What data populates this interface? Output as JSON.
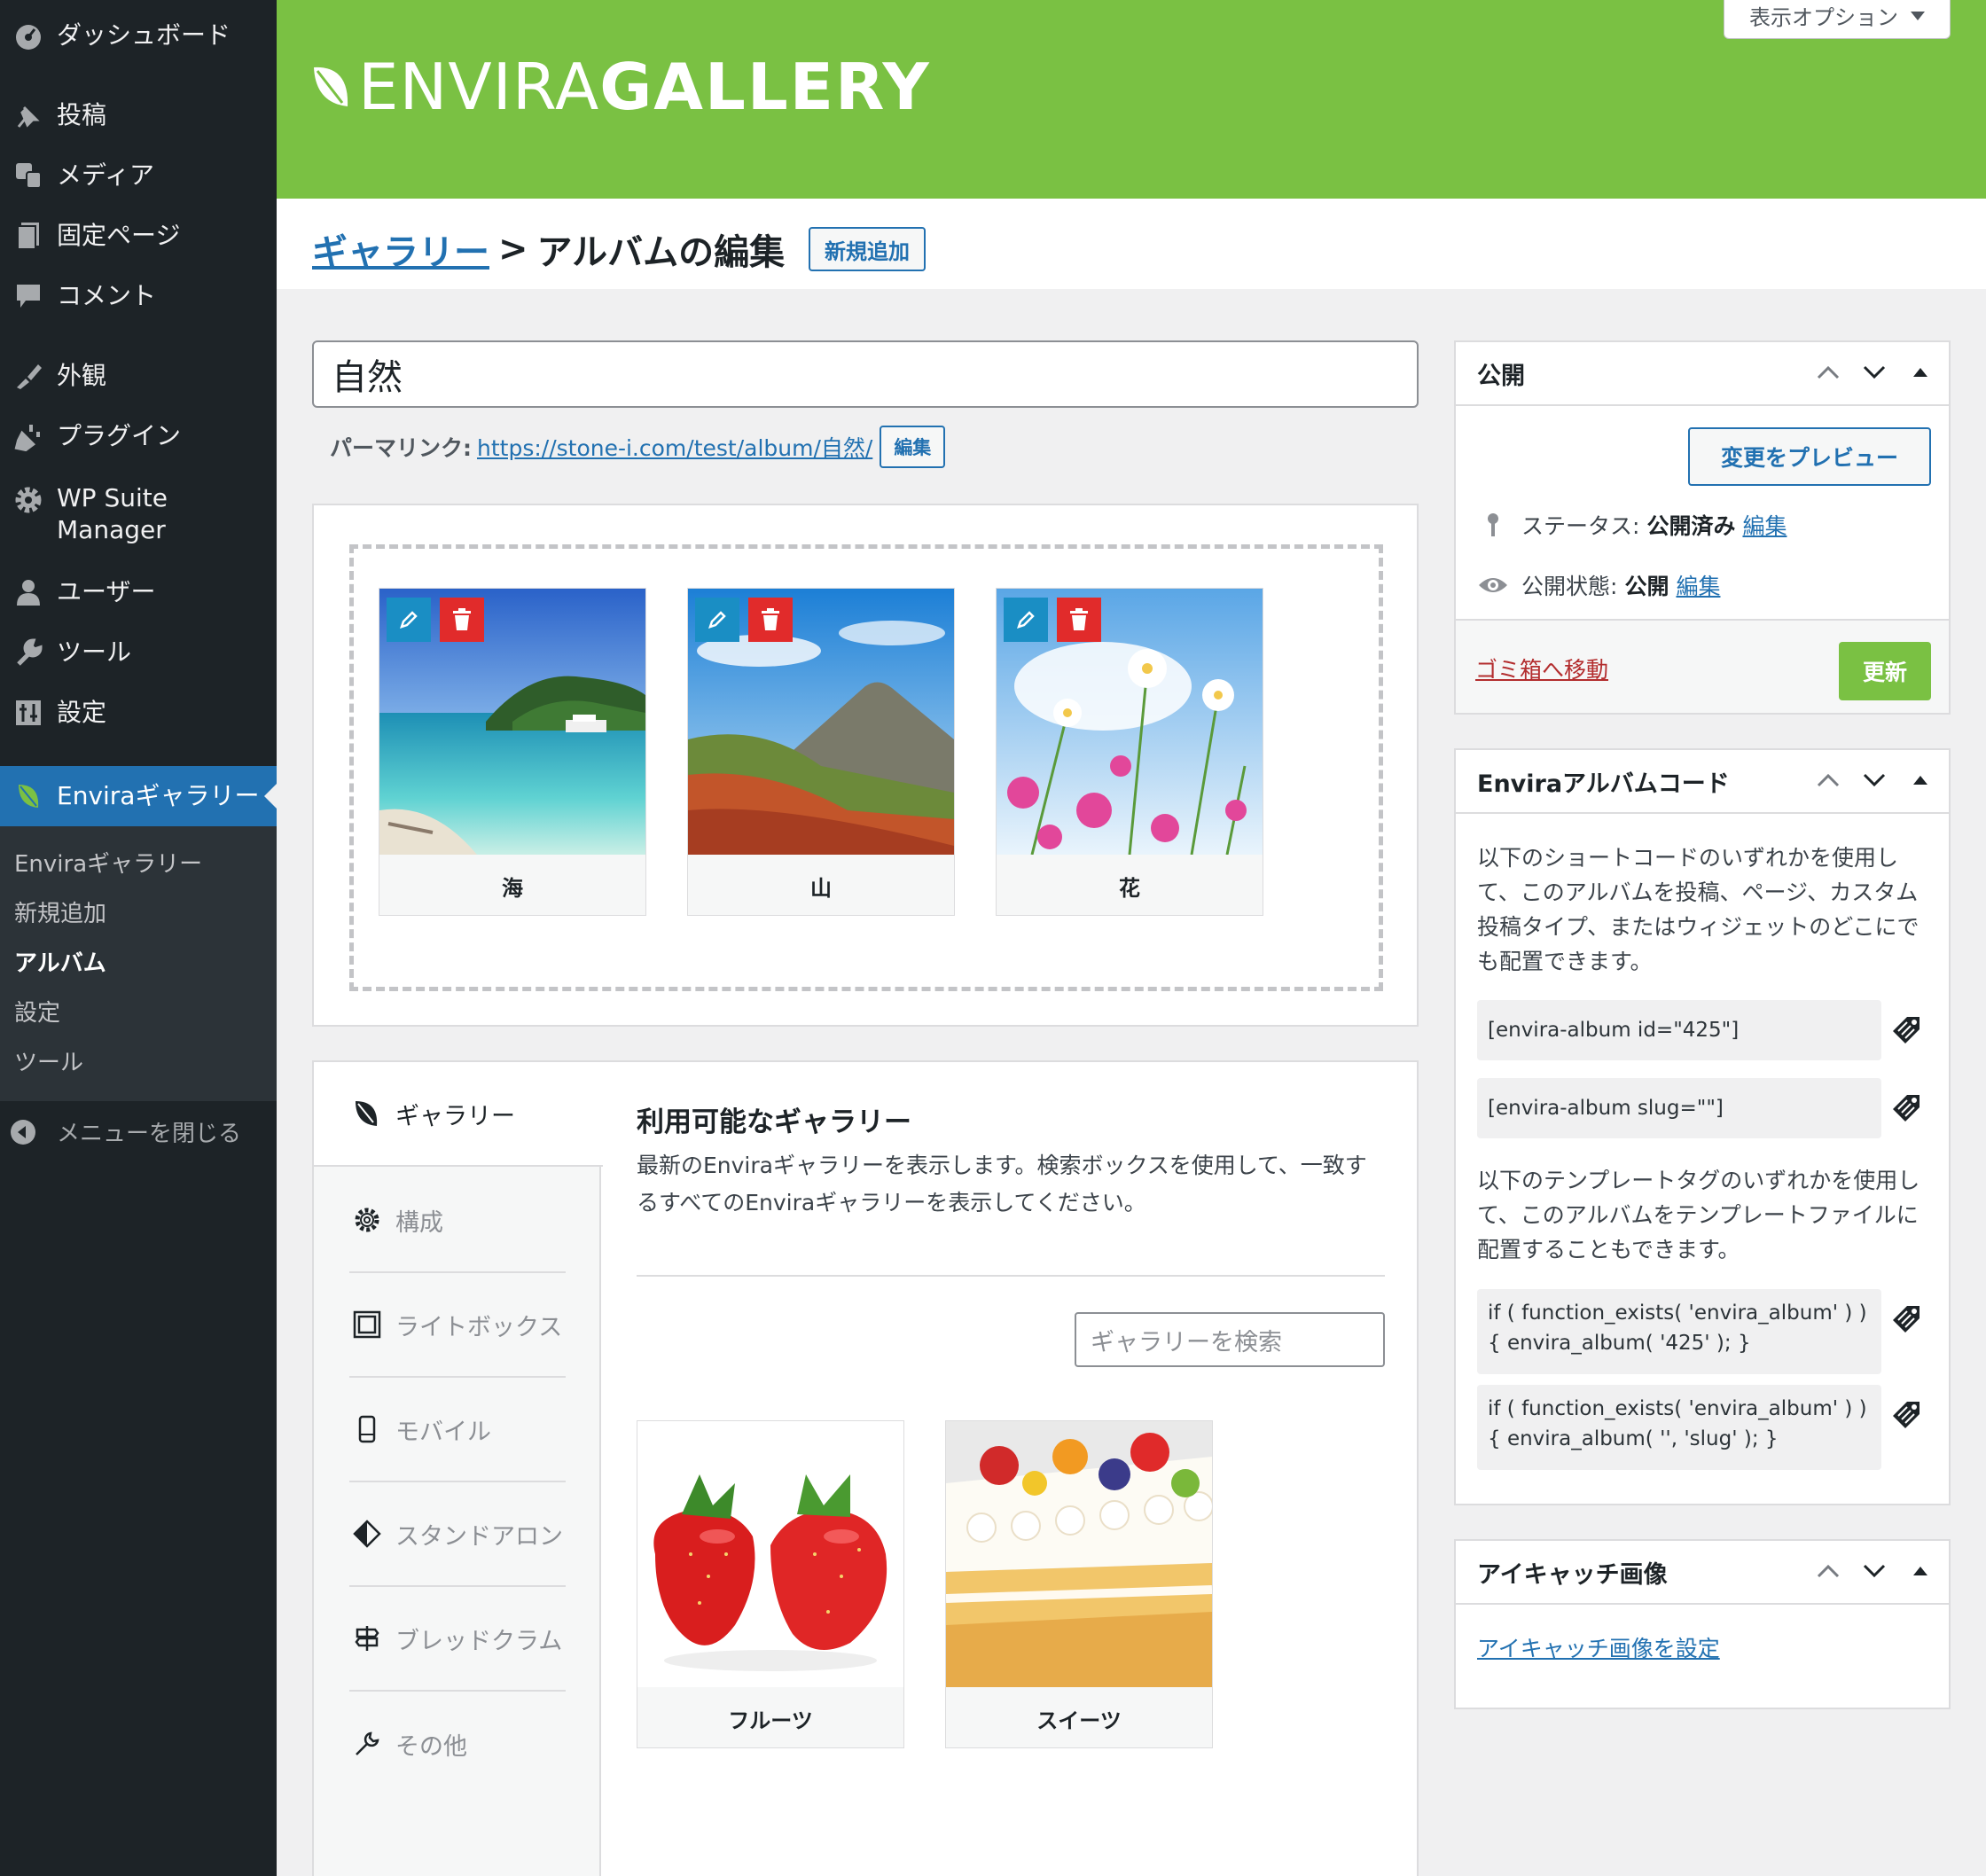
{
  "sidebar": {
    "items": [
      {
        "label": "ダッシュボード",
        "icon": "dashboard-icon"
      },
      {
        "label": "投稿",
        "icon": "pin-icon"
      },
      {
        "label": "メディア",
        "icon": "media-icon"
      },
      {
        "label": "固定ページ",
        "icon": "page-icon"
      },
      {
        "label": "コメント",
        "icon": "comment-icon"
      },
      {
        "label": "外観",
        "icon": "brush-icon"
      },
      {
        "label": "プラグイン",
        "icon": "plugin-icon"
      },
      {
        "label": "WP Suite Manager",
        "icon": "gear-icon"
      },
      {
        "label": "ユーザー",
        "icon": "user-icon"
      },
      {
        "label": "ツール",
        "icon": "wrench-icon"
      },
      {
        "label": "設定",
        "icon": "settings-icon"
      },
      {
        "label": "Enviraギャラリー",
        "icon": "envira-leaf-icon"
      }
    ],
    "submenu": [
      "Enviraギャラリー",
      "新規追加",
      "アルバム",
      "設定",
      "ツール"
    ],
    "collapse_label": "メニューを閉じる",
    "accent_color": "#2271b1"
  },
  "header": {
    "brand_light": "ENVIRA",
    "brand_bold": "GALLERY",
    "brand_color": "#7ac143",
    "screen_options": "表示オプション"
  },
  "title_bar": {
    "crumb_link": "ギャラリー",
    "separator": ">",
    "crumb_current": "アルバムの編集",
    "add_new": "新規追加"
  },
  "post": {
    "title": "自然",
    "permalink_label": "パーマリンク:",
    "permalink_url": "https://stone-i.com/test/album/自然/",
    "permalink_edit": "編集"
  },
  "album_items": [
    {
      "caption": "海"
    },
    {
      "caption": "山"
    },
    {
      "caption": "花"
    }
  ],
  "tabs": [
    {
      "label": "ギャラリー",
      "icon": "envira-leaf-icon"
    },
    {
      "label": "構成",
      "icon": "gear-icon"
    },
    {
      "label": "ライトボックス",
      "icon": "lightbox-icon"
    },
    {
      "label": "モバイル",
      "icon": "mobile-icon"
    },
    {
      "label": "スタンドアロン",
      "icon": "standalone-icon"
    },
    {
      "label": "ブレッドクラム",
      "icon": "signpost-icon"
    },
    {
      "label": "その他",
      "icon": "wrench-icon"
    }
  ],
  "gallery_panel": {
    "title": "利用可能なギャラリー",
    "description": "最新のEnviraギャラリーを表示します。検索ボックスを使用して、一致するすべてのEnviraギャラリーを表示してください。",
    "search_placeholder": "ギャラリーを検索",
    "galleries": [
      {
        "caption": "フルーツ"
      },
      {
        "caption": "スイーツ"
      }
    ]
  },
  "publish_box": {
    "title": "公開",
    "preview_button": "変更をプレビュー",
    "status_label": "ステータス:",
    "status_value": "公開済み",
    "status_edit": "編集",
    "visibility_label": "公開状態:",
    "visibility_value": "公開",
    "visibility_edit": "編集",
    "trash_link": "ゴミ箱へ移動",
    "update_button": "更新"
  },
  "code_box": {
    "title": "Enviraアルバムコード",
    "shortcode_intro": "以下のショートコードのいずれかを使用して、このアルバムを投稿、ページ、カスタム投稿タイプ、またはウィジェットのどこにでも配置できます。",
    "shortcode_id": "[envira-album id=\"425\"]",
    "shortcode_slug": "[envira-album slug=\"\"]",
    "template_intro": "以下のテンプレートタグのいずれかを使用して、このアルバムをテンプレートファイルに配置することもできます。",
    "template_id": "if ( function_exists( 'envira_album' ) ) { envira_album( '425' ); }",
    "template_slug": "if ( function_exists( 'envira_album' ) ) { envira_album( '', 'slug' ); }"
  },
  "featured_box": {
    "title": "アイキャッチ画像",
    "set_link": "アイキャッチ画像を設定"
  }
}
